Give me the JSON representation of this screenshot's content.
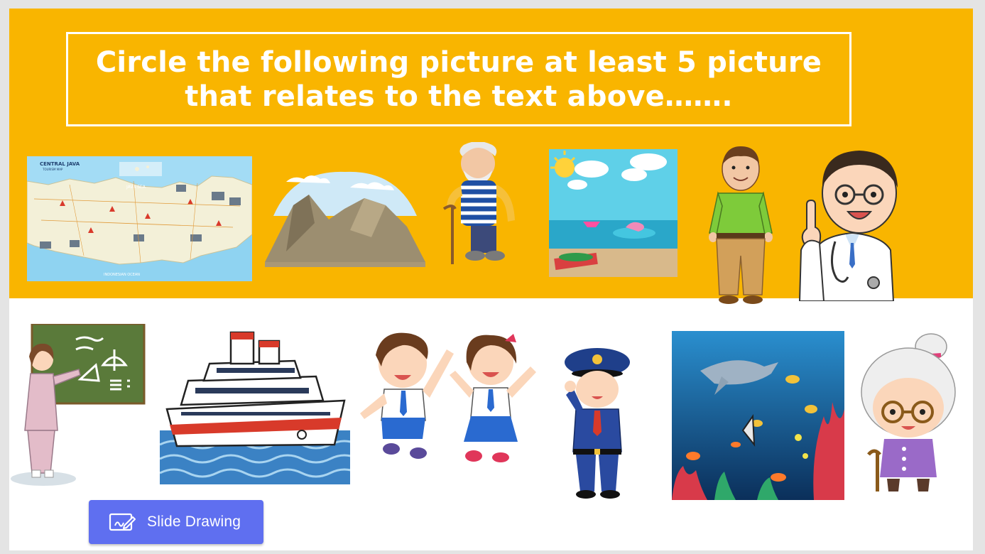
{
  "colors": {
    "band": "#f9b500",
    "page_bg": "#e4e4e4",
    "slide_bg": "#ffffff",
    "button": "#5f6ff0"
  },
  "title": {
    "line1": "Circle the following picture at least 5 picture",
    "line2": "that relates to the text above……."
  },
  "images": {
    "map_title": "CENTRAL JAVA",
    "map_subtitle": "TOURISM MAP",
    "map_sea": "JAVA SEA",
    "map_ocean": "INDONESIAN OCEAN"
  },
  "toolbar": {
    "slide_drawing_label": "Slide Drawing",
    "slide_drawing_icon": "pen-drawing-icon"
  }
}
